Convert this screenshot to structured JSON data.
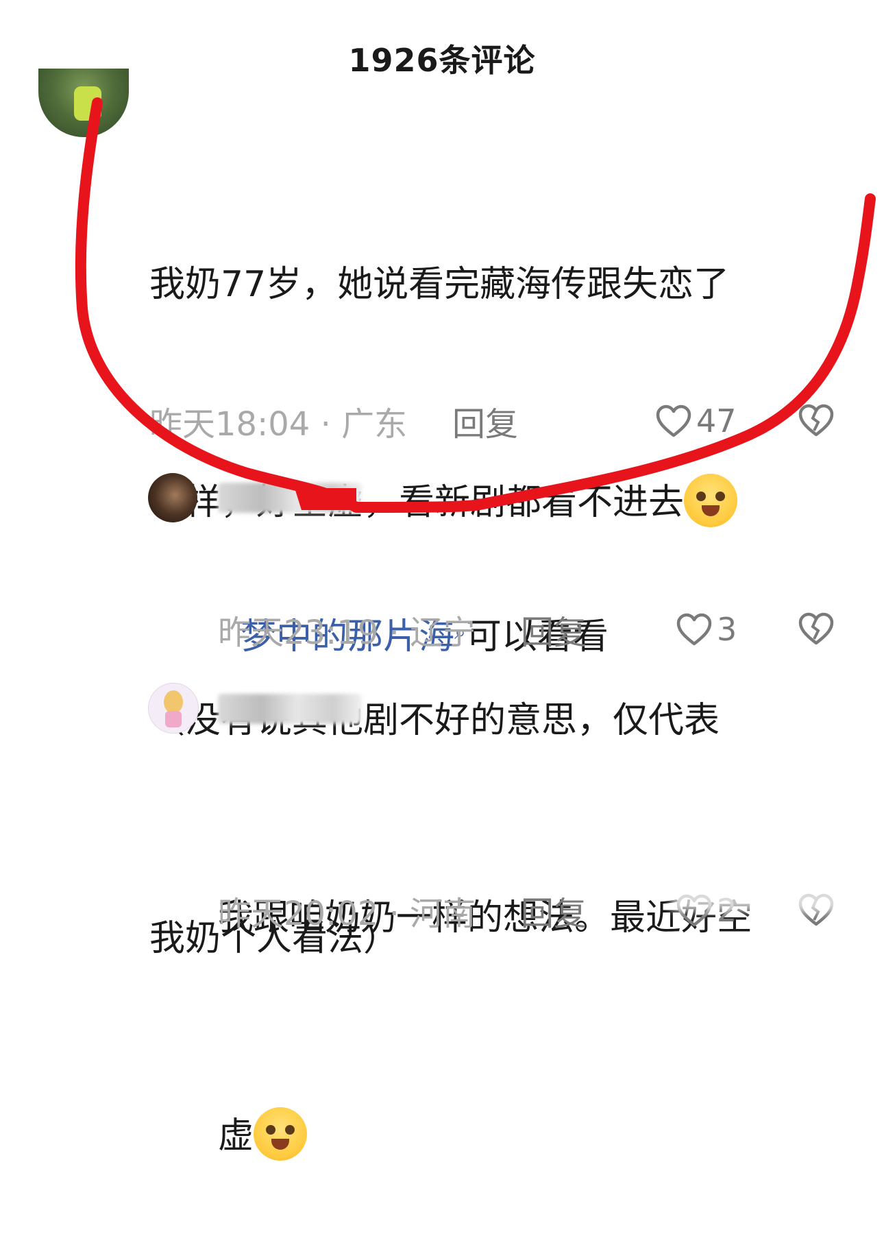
{
  "header": {
    "title": "1926条评论"
  },
  "main_comment": {
    "text_line1": "我奶77岁，她说看完藏海传跟失恋了",
    "text_line2": "一样，好空虚，看新剧都看不进去",
    "text_line3": "（没有说其他剧不好的意思，仅代表",
    "text_line4": "我奶个人看法）",
    "time_location": "昨天18:04 · 广东",
    "reply_label": "回复",
    "like_count": "47",
    "emoji": "loudly-crying-emoji"
  },
  "replies": [
    {
      "mention": "梦中的那片海",
      "text": "可以看看",
      "time_location": "昨天23:19 · 辽宁",
      "reply_label": "回复",
      "like_count": "3"
    },
    {
      "text_line1": "我跟咱奶奶一样的想法。最近好空",
      "text_line2": "虚",
      "time_location": "昨天20:02 · 河南",
      "reply_label": "回复",
      "like_count": "2",
      "emoji": "pleading-crying-emoji"
    }
  ],
  "icons": {
    "like": "heart-icon",
    "dislike": "broken-heart-icon",
    "search": "search-icon"
  },
  "colors": {
    "annotation": "#e8141c",
    "link": "#3b5fa8",
    "meta": "#a9a9a9"
  }
}
